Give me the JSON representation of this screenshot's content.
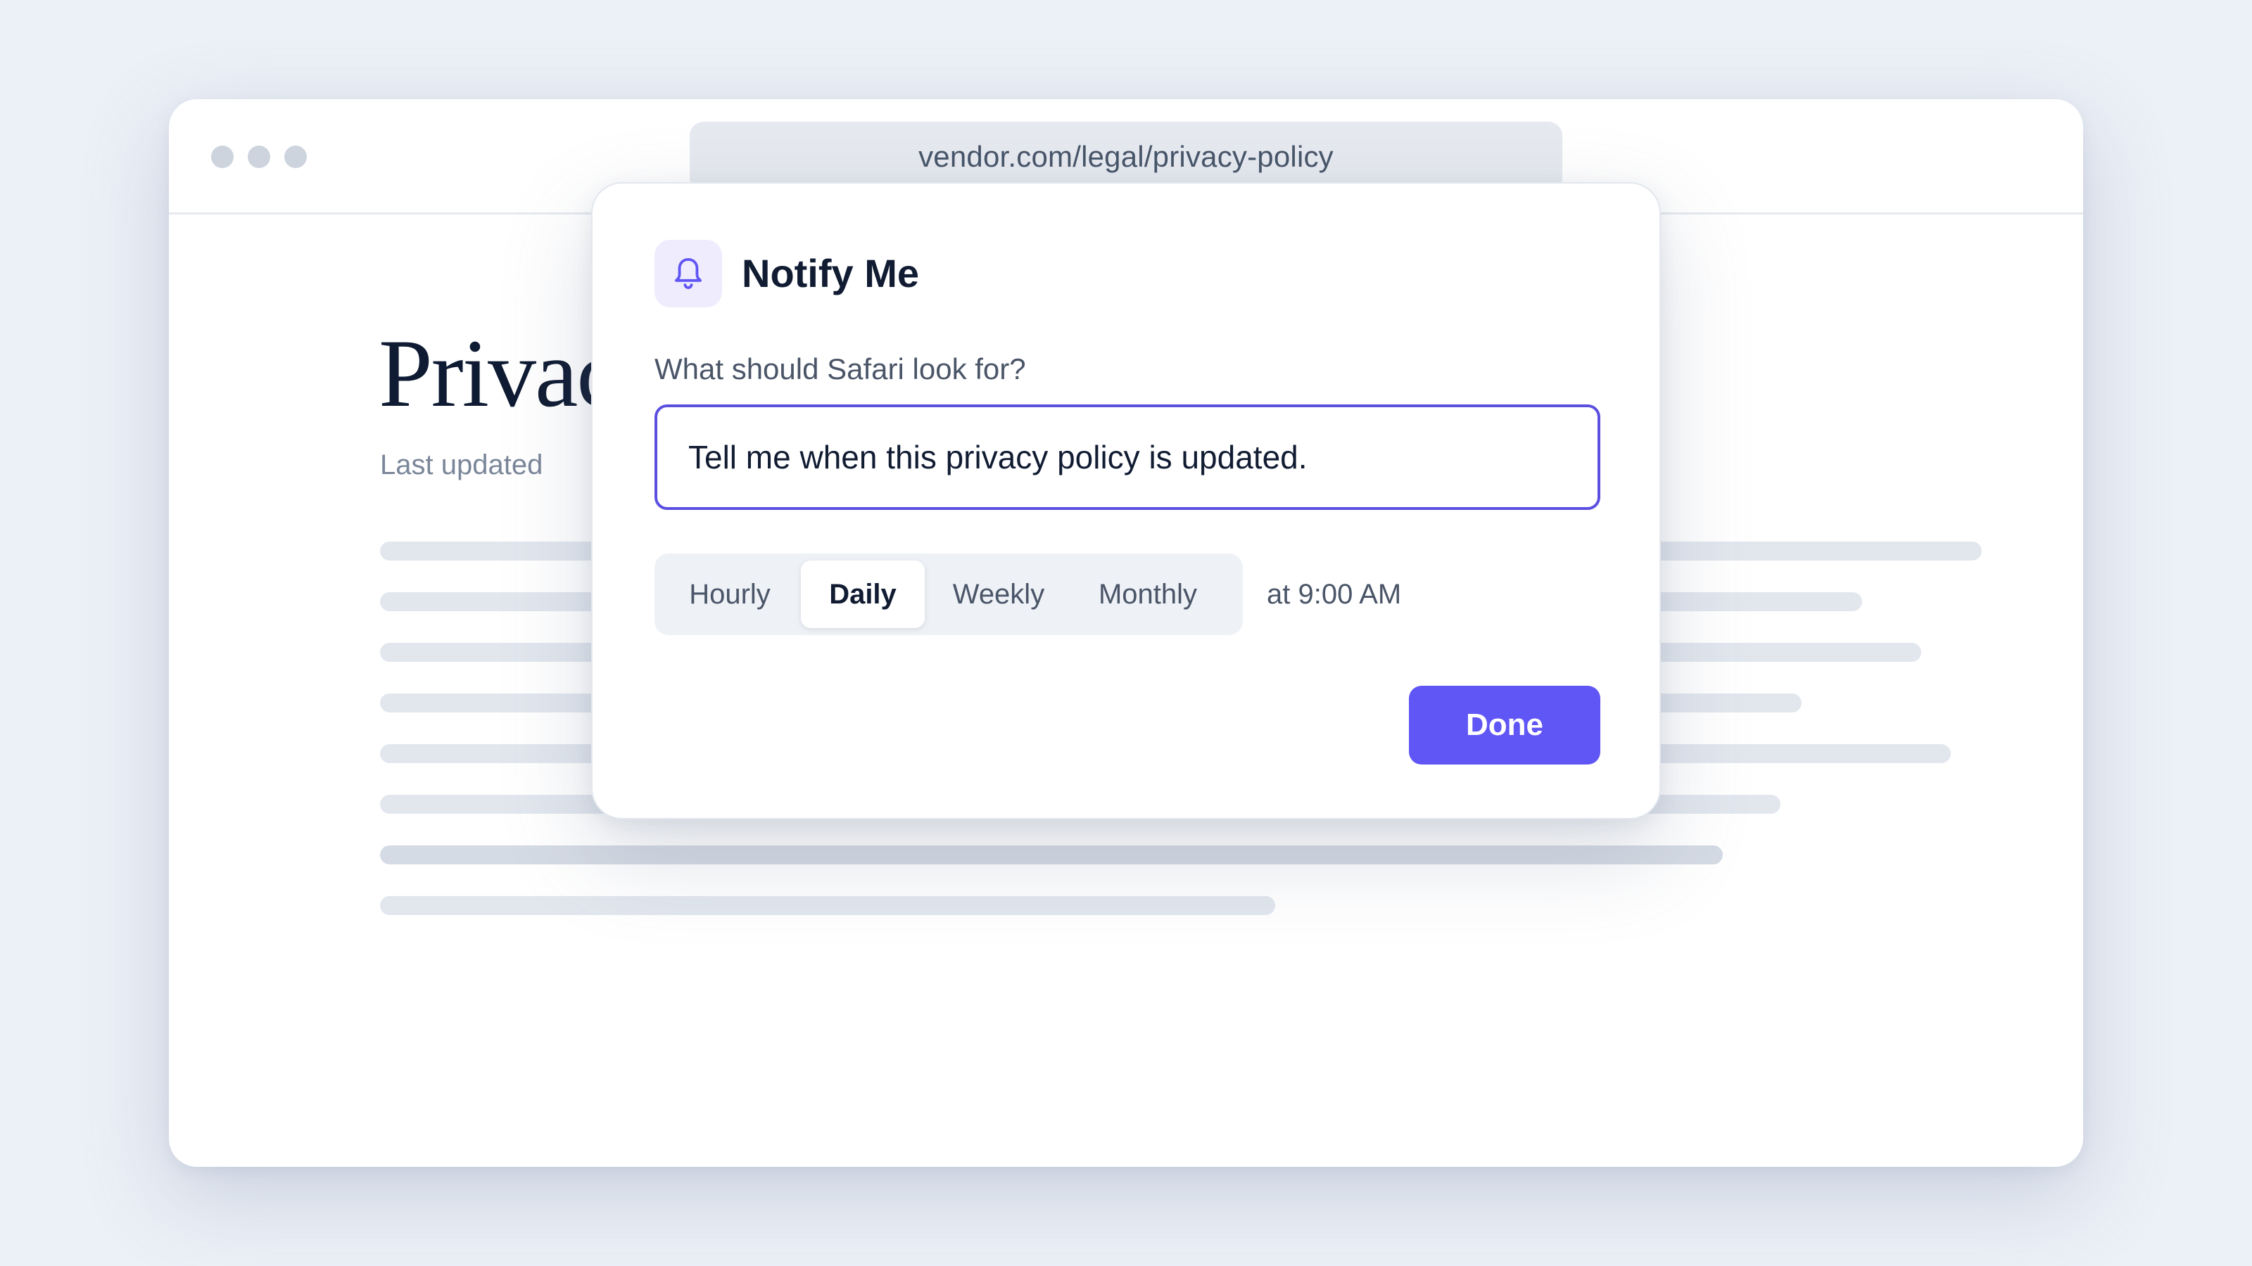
{
  "browser": {
    "url": "vendor.com/legal/privacy-policy"
  },
  "page": {
    "title": "Privacy",
    "last_updated": "Last updated"
  },
  "dialog": {
    "icon": "bell-icon",
    "title": "Notify Me",
    "prompt_label": "What should Safari look for?",
    "query_value": "Tell me when this privacy policy is updated.",
    "frequency_options": [
      "Hourly",
      "Daily",
      "Weekly",
      "Monthly"
    ],
    "selected_frequency": "Daily",
    "time_text": "at 9:00 AM",
    "done_label": "Done"
  },
  "colors": {
    "accent": "#6055f5",
    "input_border": "#5b4fe0",
    "background": "#ecf0f7"
  }
}
